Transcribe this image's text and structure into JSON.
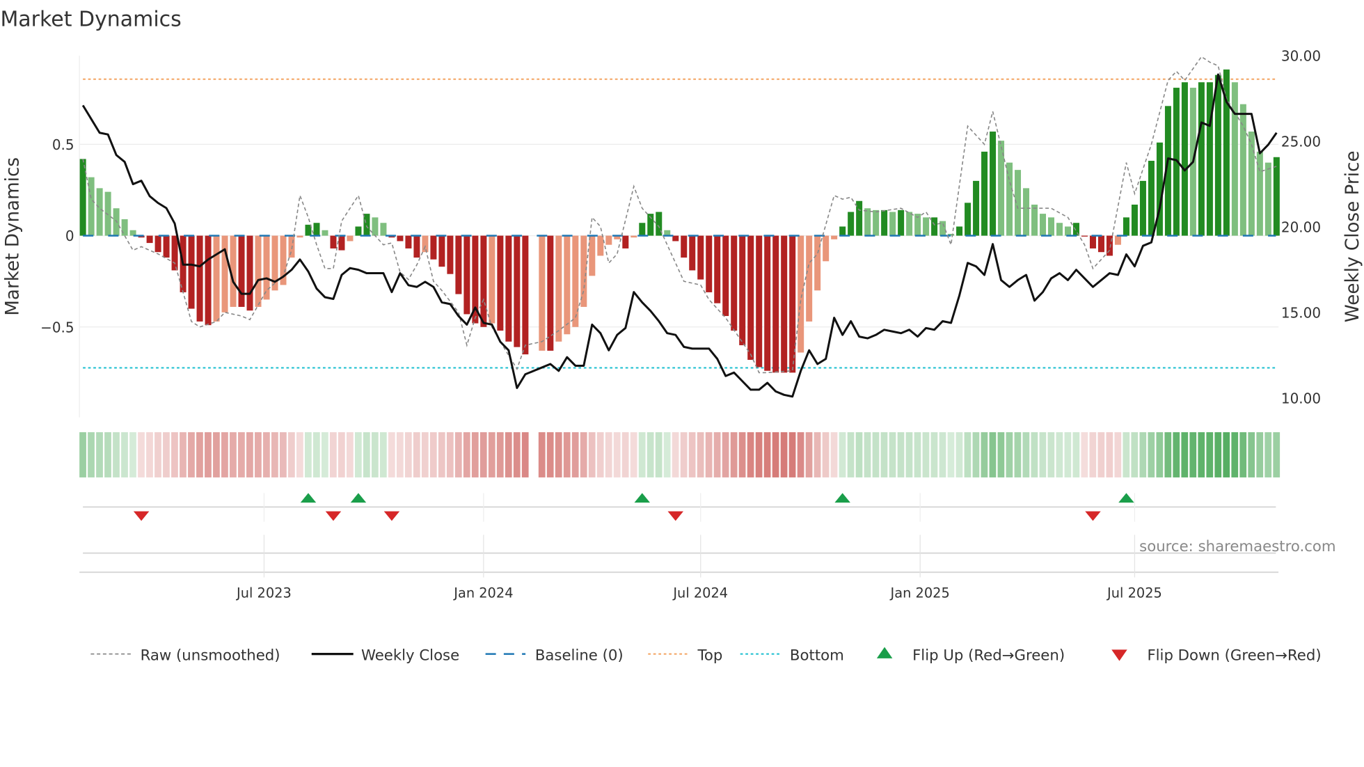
{
  "chart_data": {
    "type": "bar",
    "title": "Market Dynamics",
    "ylabel": "Market Dynamics",
    "y2label": "Weekly Close Price",
    "ylim": [
      -1.0,
      0.97
    ],
    "y2lim": [
      9.6,
      30.4
    ],
    "yticks": [
      {
        "v": 0.5,
        "label": "0.5"
      },
      {
        "v": 0,
        "label": "0"
      },
      {
        "v": -0.5,
        "label": "−0.5"
      }
    ],
    "y2ticks": [
      {
        "v": 30,
        "label": "30.00"
      },
      {
        "v": 25,
        "label": "25.00"
      },
      {
        "v": 20,
        "label": "20.00"
      },
      {
        "v": 15,
        "label": "15.00"
      },
      {
        "v": 10,
        "label": "10.00"
      }
    ],
    "x_unit": "week index",
    "xticks": [
      {
        "week": 21.7,
        "label": "Jul 2023"
      },
      {
        "week": 48,
        "label": "Jan 2024"
      },
      {
        "week": 74,
        "label": "Jul 2024"
      },
      {
        "week": 100.3,
        "label": "Jan 2025"
      },
      {
        "week": 126,
        "label": "Jul 2025"
      }
    ],
    "top_level": 0.857,
    "bottom_level": -0.724,
    "baseline": 0,
    "dynamics": [
      0.42,
      0.32,
      0.26,
      0.24,
      0.15,
      0.09,
      0.03,
      -0.01,
      -0.04,
      -0.09,
      -0.12,
      -0.19,
      -0.31,
      -0.4,
      -0.47,
      -0.49,
      -0.47,
      -0.42,
      -0.39,
      -0.39,
      -0.41,
      -0.39,
      -0.35,
      -0.3,
      -0.27,
      -0.12,
      -0.01,
      0.06,
      0.07,
      0.03,
      -0.07,
      -0.08,
      -0.03,
      0.05,
      0.12,
      0.1,
      0.07,
      -0.01,
      -0.03,
      -0.07,
      -0.12,
      -0.09,
      -0.13,
      -0.17,
      -0.21,
      -0.32,
      -0.43,
      -0.48,
      -0.5,
      -0.48,
      -0.52,
      -0.58,
      -0.61,
      -0.65,
      null,
      -0.63,
      -0.63,
      -0.58,
      -0.54,
      -0.5,
      -0.39,
      -0.22,
      -0.11,
      -0.05,
      -0.02,
      -0.07,
      -0.01,
      0.07,
      0.12,
      0.13,
      0.03,
      -0.03,
      -0.12,
      -0.19,
      -0.24,
      -0.31,
      -0.37,
      -0.44,
      -0.52,
      -0.6,
      -0.68,
      -0.72,
      -0.74,
      -0.75,
      -0.75,
      -0.75,
      -0.64,
      -0.47,
      -0.3,
      -0.14,
      -0.02,
      0.05,
      0.13,
      0.19,
      0.15,
      0.14,
      0.14,
      0.13,
      0.14,
      0.13,
      0.12,
      0.1,
      0.1,
      0.08,
      0.01,
      0.05,
      0.18,
      0.3,
      0.46,
      0.57,
      0.52,
      0.4,
      0.36,
      0.26,
      0.17,
      0.12,
      0.1,
      0.07,
      0.05,
      0.07,
      -0.005,
      -0.07,
      -0.09,
      -0.11,
      -0.05,
      0.1,
      0.17,
      0.3,
      0.41,
      0.51,
      0.71,
      0.81,
      0.84,
      0.81,
      0.84,
      0.84,
      0.88,
      0.91,
      0.84,
      0.72,
      0.57,
      0.46,
      0.4,
      0.43
    ],
    "weekly_close": [
      27.1,
      26.3,
      25.5,
      25.4,
      24.2,
      23.8,
      22.5,
      22.7,
      21.8,
      21.4,
      21.1,
      20.2,
      17.8,
      17.8,
      17.7,
      18.1,
      18.4,
      18.7,
      16.8,
      16.1,
      16.1,
      16.9,
      17.0,
      16.8,
      17.1,
      17.5,
      18.1,
      17.4,
      16.4,
      15.9,
      15.8,
      17.2,
      17.6,
      17.5,
      17.3,
      17.3,
      17.3,
      16.2,
      17.3,
      16.6,
      16.5,
      16.8,
      16.5,
      15.6,
      15.5,
      14.8,
      14.3,
      15.3,
      14.4,
      14.3,
      13.3,
      12.8,
      10.6,
      11.4,
      11.6,
      11.8,
      12.0,
      11.6,
      12.4,
      11.9,
      11.9,
      14.3,
      13.8,
      12.8,
      13.7,
      14.1,
      16.2,
      15.6,
      15.1,
      14.5,
      13.8,
      13.7,
      13.0,
      12.9,
      12.9,
      12.9,
      12.3,
      11.3,
      11.5,
      11.0,
      10.5,
      10.5,
      10.9,
      10.4,
      10.2,
      10.1,
      11.6,
      12.8,
      12.0,
      12.3,
      14.7,
      13.7,
      14.5,
      13.6,
      13.5,
      13.7,
      14.0,
      13.9,
      13.8,
      14.0,
      13.6,
      14.1,
      14.0,
      14.5,
      14.4,
      16.0,
      17.9,
      17.7,
      17.2,
      19.0,
      16.9,
      16.5,
      16.9,
      17.2,
      15.7,
      16.2,
      17.0,
      17.3,
      16.9,
      17.5,
      17.0,
      16.5,
      16.9,
      17.3,
      17.2,
      18.4,
      17.7,
      18.9,
      19.1,
      21.1,
      24.0,
      23.9,
      23.3,
      23.8,
      26.1,
      25.9,
      28.9,
      27.3,
      26.6,
      26.6,
      26.6,
      24.3,
      24.8,
      25.5
    ],
    "raw": [
      [
        0,
        0.42
      ],
      [
        1,
        0.2
      ],
      [
        2,
        0.15
      ],
      [
        4,
        0.08
      ],
      [
        6,
        -0.08
      ],
      [
        7,
        -0.06
      ],
      [
        9,
        -0.1
      ],
      [
        11,
        -0.15
      ],
      [
        13,
        -0.47
      ],
      [
        14,
        -0.5
      ],
      [
        16,
        -0.47
      ],
      [
        17,
        -0.42
      ],
      [
        19,
        -0.44
      ],
      [
        20,
        -0.46
      ],
      [
        22,
        -0.3
      ],
      [
        24,
        -0.22
      ],
      [
        25,
        -0.08
      ],
      [
        26,
        0.22
      ],
      [
        27,
        0.1
      ],
      [
        28,
        -0.05
      ],
      [
        29,
        -0.18
      ],
      [
        30,
        -0.18
      ],
      [
        31,
        0.08
      ],
      [
        32,
        0.15
      ],
      [
        33,
        0.22
      ],
      [
        34,
        0.05
      ],
      [
        35,
        0.0
      ],
      [
        36,
        -0.05
      ],
      [
        37,
        -0.04
      ],
      [
        38,
        -0.2
      ],
      [
        39,
        -0.24
      ],
      [
        40,
        -0.16
      ],
      [
        41,
        -0.06
      ],
      [
        42,
        -0.25
      ],
      [
        43,
        -0.3
      ],
      [
        45,
        -0.42
      ],
      [
        46,
        -0.6
      ],
      [
        47,
        -0.45
      ],
      [
        48,
        -0.35
      ],
      [
        49,
        -0.5
      ],
      [
        50,
        -0.58
      ],
      [
        52,
        -0.73
      ],
      [
        53,
        -0.6
      ],
      [
        55,
        -0.58
      ],
      [
        57,
        -0.52
      ],
      [
        59,
        -0.45
      ],
      [
        60,
        -0.3
      ],
      [
        61,
        0.1
      ],
      [
        62,
        0.05
      ],
      [
        63,
        -0.15
      ],
      [
        64,
        -0.1
      ],
      [
        66,
        0.27
      ],
      [
        67,
        0.15
      ],
      [
        69,
        0.05
      ],
      [
        70,
        -0.05
      ],
      [
        71,
        -0.15
      ],
      [
        72,
        -0.25
      ],
      [
        74,
        -0.27
      ],
      [
        75,
        -0.35
      ],
      [
        77,
        -0.45
      ],
      [
        80,
        -0.65
      ],
      [
        81,
        -0.75
      ],
      [
        82,
        -0.75
      ],
      [
        85,
        -0.74
      ],
      [
        86,
        -0.35
      ],
      [
        87,
        -0.15
      ],
      [
        88,
        -0.1
      ],
      [
        90,
        0.22
      ],
      [
        91,
        0.2
      ],
      [
        92,
        0.21
      ],
      [
        93,
        0.14
      ],
      [
        95,
        0.13
      ],
      [
        98,
        0.15
      ],
      [
        100,
        0.1
      ],
      [
        101,
        0.13
      ],
      [
        102,
        0.06
      ],
      [
        103,
        0.07
      ],
      [
        104,
        -0.05
      ],
      [
        106,
        0.6
      ],
      [
        108,
        0.5
      ],
      [
        109,
        0.68
      ],
      [
        111,
        0.3
      ],
      [
        112,
        0.15
      ],
      [
        114,
        0.15
      ],
      [
        116,
        0.15
      ],
      [
        118,
        0.1
      ],
      [
        120,
        -0.05
      ],
      [
        121,
        -0.18
      ],
      [
        123,
        -0.08
      ],
      [
        125,
        0.4
      ],
      [
        126,
        0.23
      ],
      [
        128,
        0.5
      ],
      [
        130,
        0.85
      ],
      [
        131,
        0.9
      ],
      [
        132,
        0.85
      ],
      [
        134,
        0.98
      ],
      [
        135,
        0.95
      ],
      [
        136,
        0.93
      ],
      [
        137,
        0.75
      ],
      [
        139,
        0.6
      ],
      [
        140,
        0.5
      ],
      [
        141,
        0.35
      ],
      [
        143,
        0.38
      ]
    ],
    "flip_up_weeks": [
      27,
      33,
      67,
      91,
      125
    ],
    "flip_down_weeks": [
      7,
      30,
      37,
      71,
      121
    ],
    "legend": [
      {
        "label": "Raw (unsmoothed)",
        "style": "dashed-gray"
      },
      {
        "label": "Weekly Close",
        "style": "solid-black"
      },
      {
        "label": "Baseline (0)",
        "style": "dashed-blue"
      },
      {
        "label": "Top",
        "style": "dotted-orange"
      },
      {
        "label": "Bottom",
        "style": "dotted-cyan"
      },
      {
        "label": "Flip Up (Red→Green)",
        "style": "triangle-up-green"
      },
      {
        "label": "Flip Down (Green→Red)",
        "style": "triangle-down-red"
      }
    ],
    "legend_position": "bottom",
    "source": "source: sharemaestro.com",
    "colors": {
      "pos_up": "#228b22",
      "pos_down": "#7fbf7f",
      "neg_down": "#b22222",
      "neg_up": "#e9967a",
      "strip_green": "#3fa34d",
      "strip_red": "#c9534f",
      "baseline": "#1f77b4",
      "top": "#f4a460",
      "bottom": "#17becf",
      "flip_up": "#1a9e4a",
      "flip_down": "#d62728",
      "close": "#111111",
      "raw": "#888888"
    }
  }
}
